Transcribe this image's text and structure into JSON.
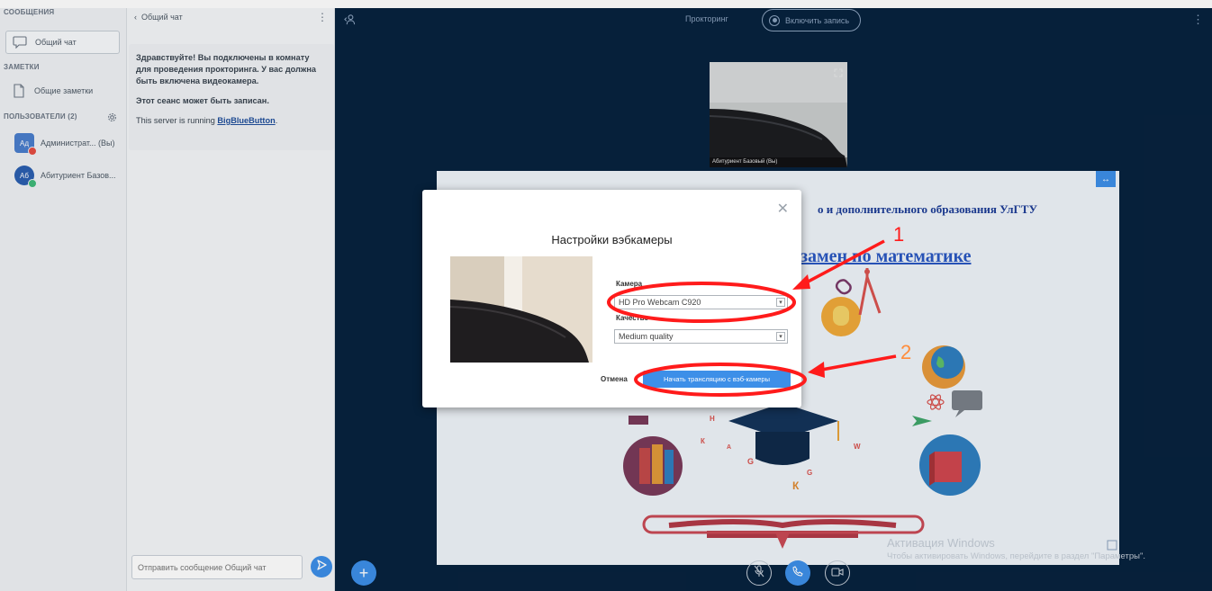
{
  "sidebar": {
    "messages_title": "СООБЩЕНИЯ",
    "public_chat_label": "Общий чат",
    "notes_title": "ЗАМЕТКИ",
    "shared_notes_label": "Общие заметки",
    "users_title": "ПОЛЬЗОВАТЕЛИ (2)",
    "users": [
      {
        "initials": "Ад",
        "name": "Администрат... (Вы)",
        "avatar_color": "#4a7ecc",
        "status_color": "#e54d42"
      },
      {
        "initials": "Аб",
        "name": "Абитуриент Базов...",
        "avatar_color": "#2b5fb0",
        "status_color": "#3fb97a"
      }
    ]
  },
  "chat": {
    "header_title": "Общий чат",
    "welcome_line1": "Здравствуйте! Вы подключены в комнату для проведения прокторинга. У вас должна быть включена видеокамера.",
    "welcome_line2": "Этот сеанс может быть записан.",
    "welcome_line3_prefix": "This server is running ",
    "welcome_link": "BigBlueButton",
    "welcome_line3_suffix": ".",
    "input_placeholder": "Отправить сообщение Общий чат"
  },
  "topbar": {
    "room_title": "Прокторинг",
    "record_label": "Включить запись"
  },
  "video": {
    "user_label": "Абитуриент Базовый (Вы)"
  },
  "slide": {
    "heading": "о и дополнительного образования УлГТУ",
    "title": "замен по математике",
    "letters": [
      "Н",
      "К",
      "G",
      "К",
      "G",
      "W",
      "А"
    ]
  },
  "watermark": {
    "line1": "Активация Windows",
    "line2": "Чтобы активировать Windows, перейдите в раздел \"Параметры\"."
  },
  "modal": {
    "title": "Настройки вэбкамеры",
    "camera_label": "Камера",
    "camera_value": "HD Pro Webcam C920",
    "quality_label": "Качество",
    "quality_value": "Medium quality",
    "cancel_label": "Отмена",
    "start_label": "Начать трансляцию с вэб-камеры"
  },
  "annotations": {
    "num1": "1",
    "num2": "2",
    "color": "#ff1b1b"
  },
  "colors": {
    "main_bg": "#07223e",
    "accent": "#3d8fe8"
  }
}
